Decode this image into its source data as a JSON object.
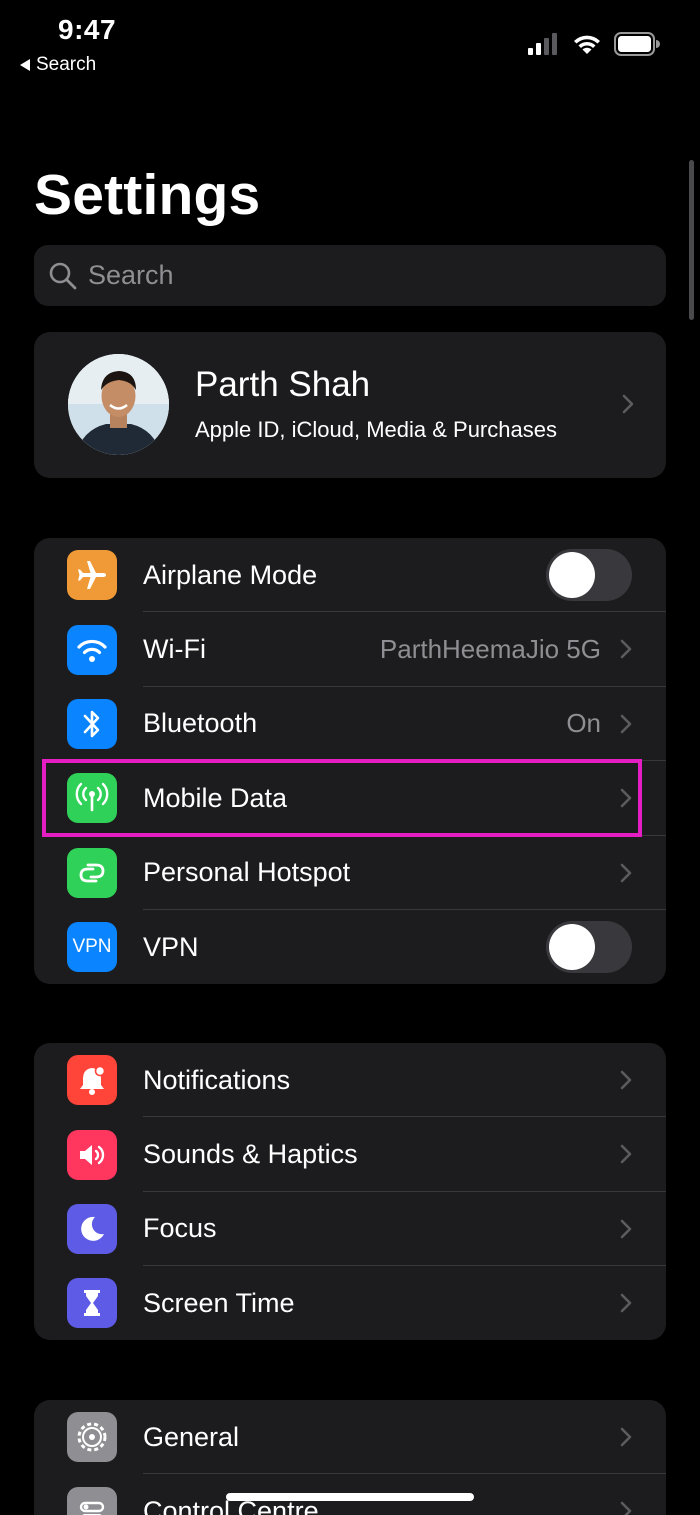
{
  "status_bar": {
    "time": "9:47",
    "back_label": "Search"
  },
  "page": {
    "title": "Settings"
  },
  "search": {
    "placeholder": "Search"
  },
  "profile": {
    "name": "Parth Shah",
    "subtitle": "Apple ID, iCloud, Media & Purchases"
  },
  "connectivity": {
    "items": [
      {
        "label": "Airplane Mode",
        "icon": "airplane-icon",
        "color": "#f09a37",
        "toggle": false
      },
      {
        "label": "Wi-Fi",
        "icon": "wifi-icon",
        "color": "#0a84ff",
        "value": "ParthHeemaJio 5G"
      },
      {
        "label": "Bluetooth",
        "icon": "bluetooth-icon",
        "color": "#0a84ff",
        "value": "On"
      },
      {
        "label": "Mobile Data",
        "icon": "antenna-icon",
        "color": "#30d158"
      },
      {
        "label": "Personal Hotspot",
        "icon": "hotspot-icon",
        "color": "#30d158"
      },
      {
        "label": "VPN",
        "icon": "vpn-icon",
        "icon_text": "VPN",
        "color": "#0a84ff",
        "toggle": false
      }
    ]
  },
  "notifications_group": {
    "items": [
      {
        "label": "Notifications",
        "icon": "bell-icon",
        "color": "#ff453a"
      },
      {
        "label": "Sounds & Haptics",
        "icon": "speaker-icon",
        "color": "#ff375f"
      },
      {
        "label": "Focus",
        "icon": "moon-icon",
        "color": "#5e5ce6"
      },
      {
        "label": "Screen Time",
        "icon": "hourglass-icon",
        "color": "#5e5ce6"
      }
    ]
  },
  "general_group": {
    "items": [
      {
        "label": "General",
        "icon": "gear-icon",
        "color": "#8e8e93"
      },
      {
        "label": "Control Centre",
        "icon": "switches-icon",
        "color": "#8e8e93"
      }
    ]
  },
  "highlight": {
    "target": "Mobile Data",
    "color": "#e51ec4"
  }
}
